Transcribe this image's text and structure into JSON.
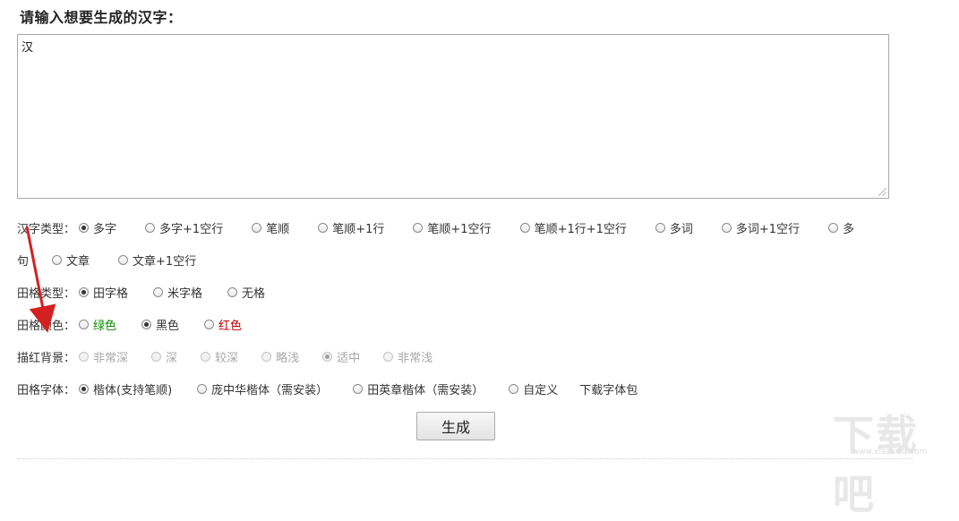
{
  "title": "请输入想要生成的汉字：",
  "input": {
    "value": "汉"
  },
  "rows": {
    "hanzi_type": {
      "label": "汉字类型：",
      "options": [
        {
          "text": "多字",
          "checked": true
        },
        {
          "text": "多字+1空行",
          "checked": false
        },
        {
          "text": "笔顺",
          "checked": false
        },
        {
          "text": "笔顺+1行",
          "checked": false
        },
        {
          "text": "笔顺+1空行",
          "checked": false
        },
        {
          "text": "笔顺+1行+1空行",
          "checked": false
        },
        {
          "text": "多词",
          "checked": false
        },
        {
          "text": "多词+1空行",
          "checked": false
        },
        {
          "text": "多",
          "checked": false
        }
      ],
      "continuation": "句",
      "options_line2": [
        {
          "text": "文章",
          "checked": false
        },
        {
          "text": "文章+1空行",
          "checked": false
        }
      ]
    },
    "grid_type": {
      "label": "田格类型：",
      "options": [
        {
          "text": "田字格",
          "checked": true
        },
        {
          "text": "米字格",
          "checked": false
        },
        {
          "text": "无格",
          "checked": false
        }
      ]
    },
    "grid_color": {
      "label": "田格颜色：",
      "options": [
        {
          "text": "绿色",
          "checked": false,
          "color": "#0a8a00"
        },
        {
          "text": "黑色",
          "checked": true,
          "color": "#333333"
        },
        {
          "text": "红色",
          "checked": false,
          "color": "#c00000"
        }
      ]
    },
    "trace_bg": {
      "label": "描红背景：",
      "options": [
        {
          "text": "非常深",
          "checked": false
        },
        {
          "text": "深",
          "checked": false
        },
        {
          "text": "较深",
          "checked": false
        },
        {
          "text": "略浅",
          "checked": false
        },
        {
          "text": "适中",
          "checked": true
        },
        {
          "text": "非常浅",
          "checked": false
        }
      ]
    },
    "grid_font": {
      "label": "田格字体：",
      "options": [
        {
          "text": "楷体(支持笔顺)",
          "checked": true
        },
        {
          "text": "庞中华楷体（需安装）",
          "checked": false
        },
        {
          "text": "田英章楷体（需安装）",
          "checked": false
        },
        {
          "text": "自定义",
          "checked": false
        }
      ],
      "download_link": "下载字体包"
    }
  },
  "generate_button": "生成",
  "watermark": {
    "text": "下载吧",
    "url": "www.xiazaiba.com"
  },
  "colors": {
    "arrow": "#d42020"
  }
}
